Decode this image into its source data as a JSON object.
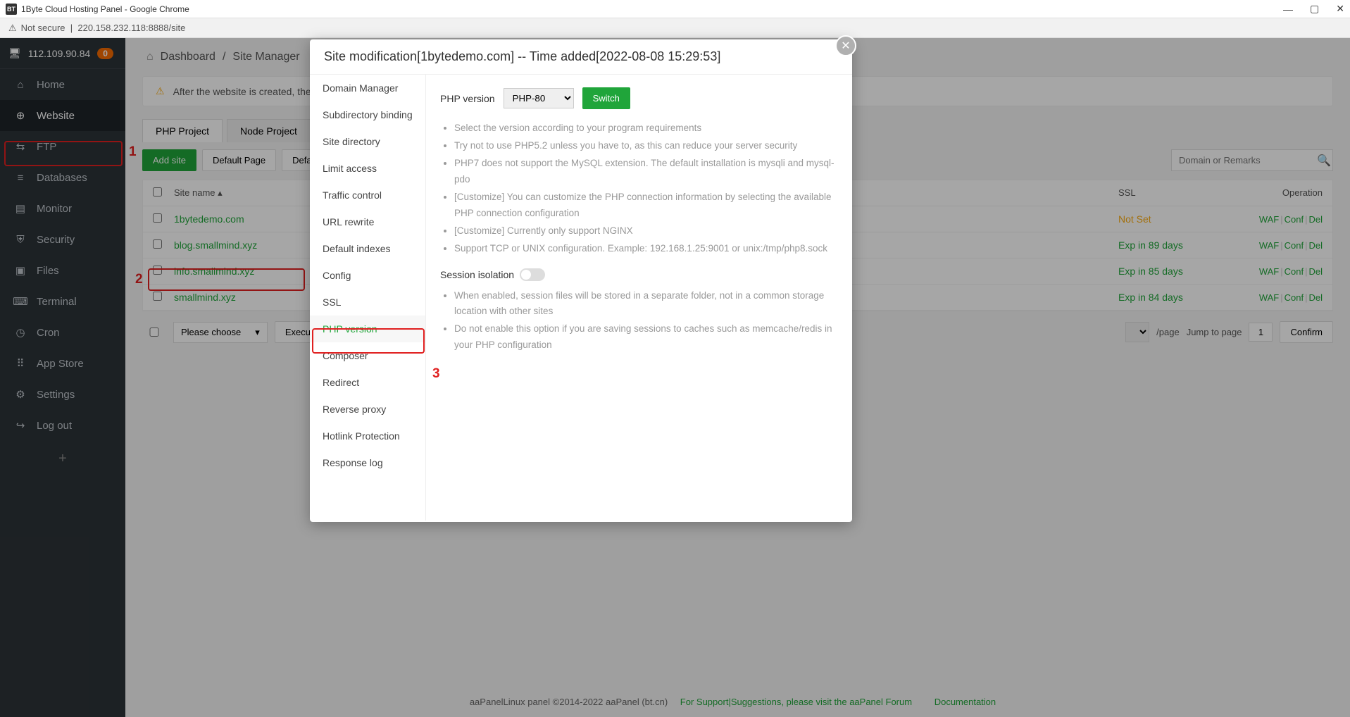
{
  "browser": {
    "title": "1Byte Cloud Hosting Panel - Google Chrome",
    "not_secure": "Not secure",
    "url": "220.158.232.118:8888/site"
  },
  "sidebar": {
    "ip": "112.109.90.84",
    "badge": "0",
    "items": [
      {
        "icon": "⌂",
        "label": "Home"
      },
      {
        "icon": "⊕",
        "label": "Website",
        "active": true
      },
      {
        "icon": "⇆",
        "label": "FTP"
      },
      {
        "icon": "≡",
        "label": "Databases"
      },
      {
        "icon": "▤",
        "label": "Monitor"
      },
      {
        "icon": "⛨",
        "label": "Security"
      },
      {
        "icon": "▣",
        "label": "Files"
      },
      {
        "icon": "⌨",
        "label": "Terminal"
      },
      {
        "icon": "◷",
        "label": "Cron"
      },
      {
        "icon": "⠿",
        "label": "App Store"
      },
      {
        "icon": "⚙",
        "label": "Settings"
      },
      {
        "icon": "↪",
        "label": "Log out"
      }
    ]
  },
  "breadcrumb": {
    "dashboard": "Dashboard",
    "page": "Site Manager"
  },
  "alert": "After the website is created, the file ... p tasks to the page!",
  "tabs": {
    "php": "PHP Project",
    "node": "Node Project"
  },
  "toolbar": {
    "add": "Add site",
    "default_page": "Default Page",
    "default_w": "Default W",
    "search_ph": "Domain or Remarks"
  },
  "table": {
    "headers": {
      "site": "Site name",
      "ssl": "SSL",
      "op": "Operation"
    },
    "rows": [
      {
        "site": "1bytedemo.com",
        "ssl": "Not Set",
        "ssl_class": "ns"
      },
      {
        "site": "blog.smallmind.xyz",
        "ssl": "Exp in 89 days",
        "ssl_class": "exp"
      },
      {
        "site": "info.smallmind.xyz",
        "ssl": "Exp in 85 days",
        "ssl_class": "exp"
      },
      {
        "site": "smallmind.xyz",
        "ssl": "Exp in 84 days",
        "ssl_class": "exp"
      }
    ],
    "ops": {
      "waf": "WAF",
      "conf": "Conf",
      "del": "Del"
    }
  },
  "pager": {
    "please": "Please choose",
    "execute": "Execute",
    "per_page": "/page",
    "jump": "Jump to page",
    "page_no": "1",
    "confirm": "Confirm"
  },
  "footer": {
    "left": "aaPanelLinux panel ©2014-2022 aaPanel (bt.cn)",
    "support": "For Support|Suggestions, please visit the aaPanel Forum",
    "docs": "Documentation"
  },
  "modal": {
    "title": "Site modification[1bytedemo.com] -- Time added[2022-08-08 15:29:53]",
    "side": [
      "Domain Manager",
      "Subdirectory binding",
      "Site directory",
      "Limit access",
      "Traffic control",
      "URL rewrite",
      "Default indexes",
      "Config",
      "SSL",
      "PHP version",
      "Composer",
      "Redirect",
      "Reverse proxy",
      "Hotlink Protection",
      "Response log"
    ],
    "php_label": "PHP version",
    "php_value": "PHP-80",
    "switch": "Switch",
    "bullets1": [
      "Select the version according to your program requirements",
      "Try not to use PHP5.2 unless you have to, as this can reduce your server security",
      "PHP7 does not support the MySQL extension. The default installation is mysqli and mysql-pdo",
      "[Customize] You can customize the PHP connection information by selecting the available PHP connection configuration",
      "[Customize] Currently only support NGINX",
      "Support TCP or UNIX configuration. Example: 192.168.1.25:9001 or unix:/tmp/php8.sock"
    ],
    "sess_label": "Session isolation",
    "bullets2": [
      "When enabled, session files will be stored in a separate folder, not in a common storage location with other sites",
      "Do not enable this option if you are saving sessions to caches such as memcache/redis in your PHP configuration"
    ]
  },
  "annotations": {
    "n1": "1",
    "n2": "2",
    "n3": "3"
  }
}
